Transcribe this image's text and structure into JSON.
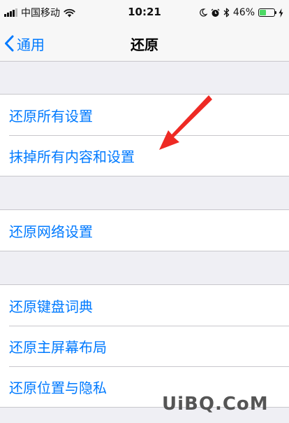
{
  "status_bar": {
    "carrier": "中国移动",
    "time": "10:21",
    "battery_percent": "46%",
    "battery_level": 0.46,
    "battery_color": "#4cd964",
    "icons": [
      "signal-icon",
      "wifi-icon",
      "moon-icon",
      "alarm-icon",
      "bluetooth-icon",
      "battery-icon",
      "charging-icon"
    ]
  },
  "nav": {
    "back_label": "通用",
    "back_icon": "chevron-left-icon",
    "title": "还原"
  },
  "groups": [
    {
      "items": [
        {
          "label": "还原所有设置"
        },
        {
          "label": "抹掉所有内容和设置"
        }
      ]
    },
    {
      "items": [
        {
          "label": "还原网络设置"
        }
      ]
    },
    {
      "items": [
        {
          "label": "还原键盘词典"
        },
        {
          "label": "还原主屏幕布局"
        },
        {
          "label": "还原位置与隐私"
        }
      ]
    }
  ],
  "annotation": {
    "arrow_color": "#ee2a24",
    "points_to": "抹掉所有内容和设置"
  },
  "watermark": "UiBQ.CoM",
  "colors": {
    "accent": "#007aff",
    "background": "#efeff4",
    "separator": "#c8c7cc"
  }
}
